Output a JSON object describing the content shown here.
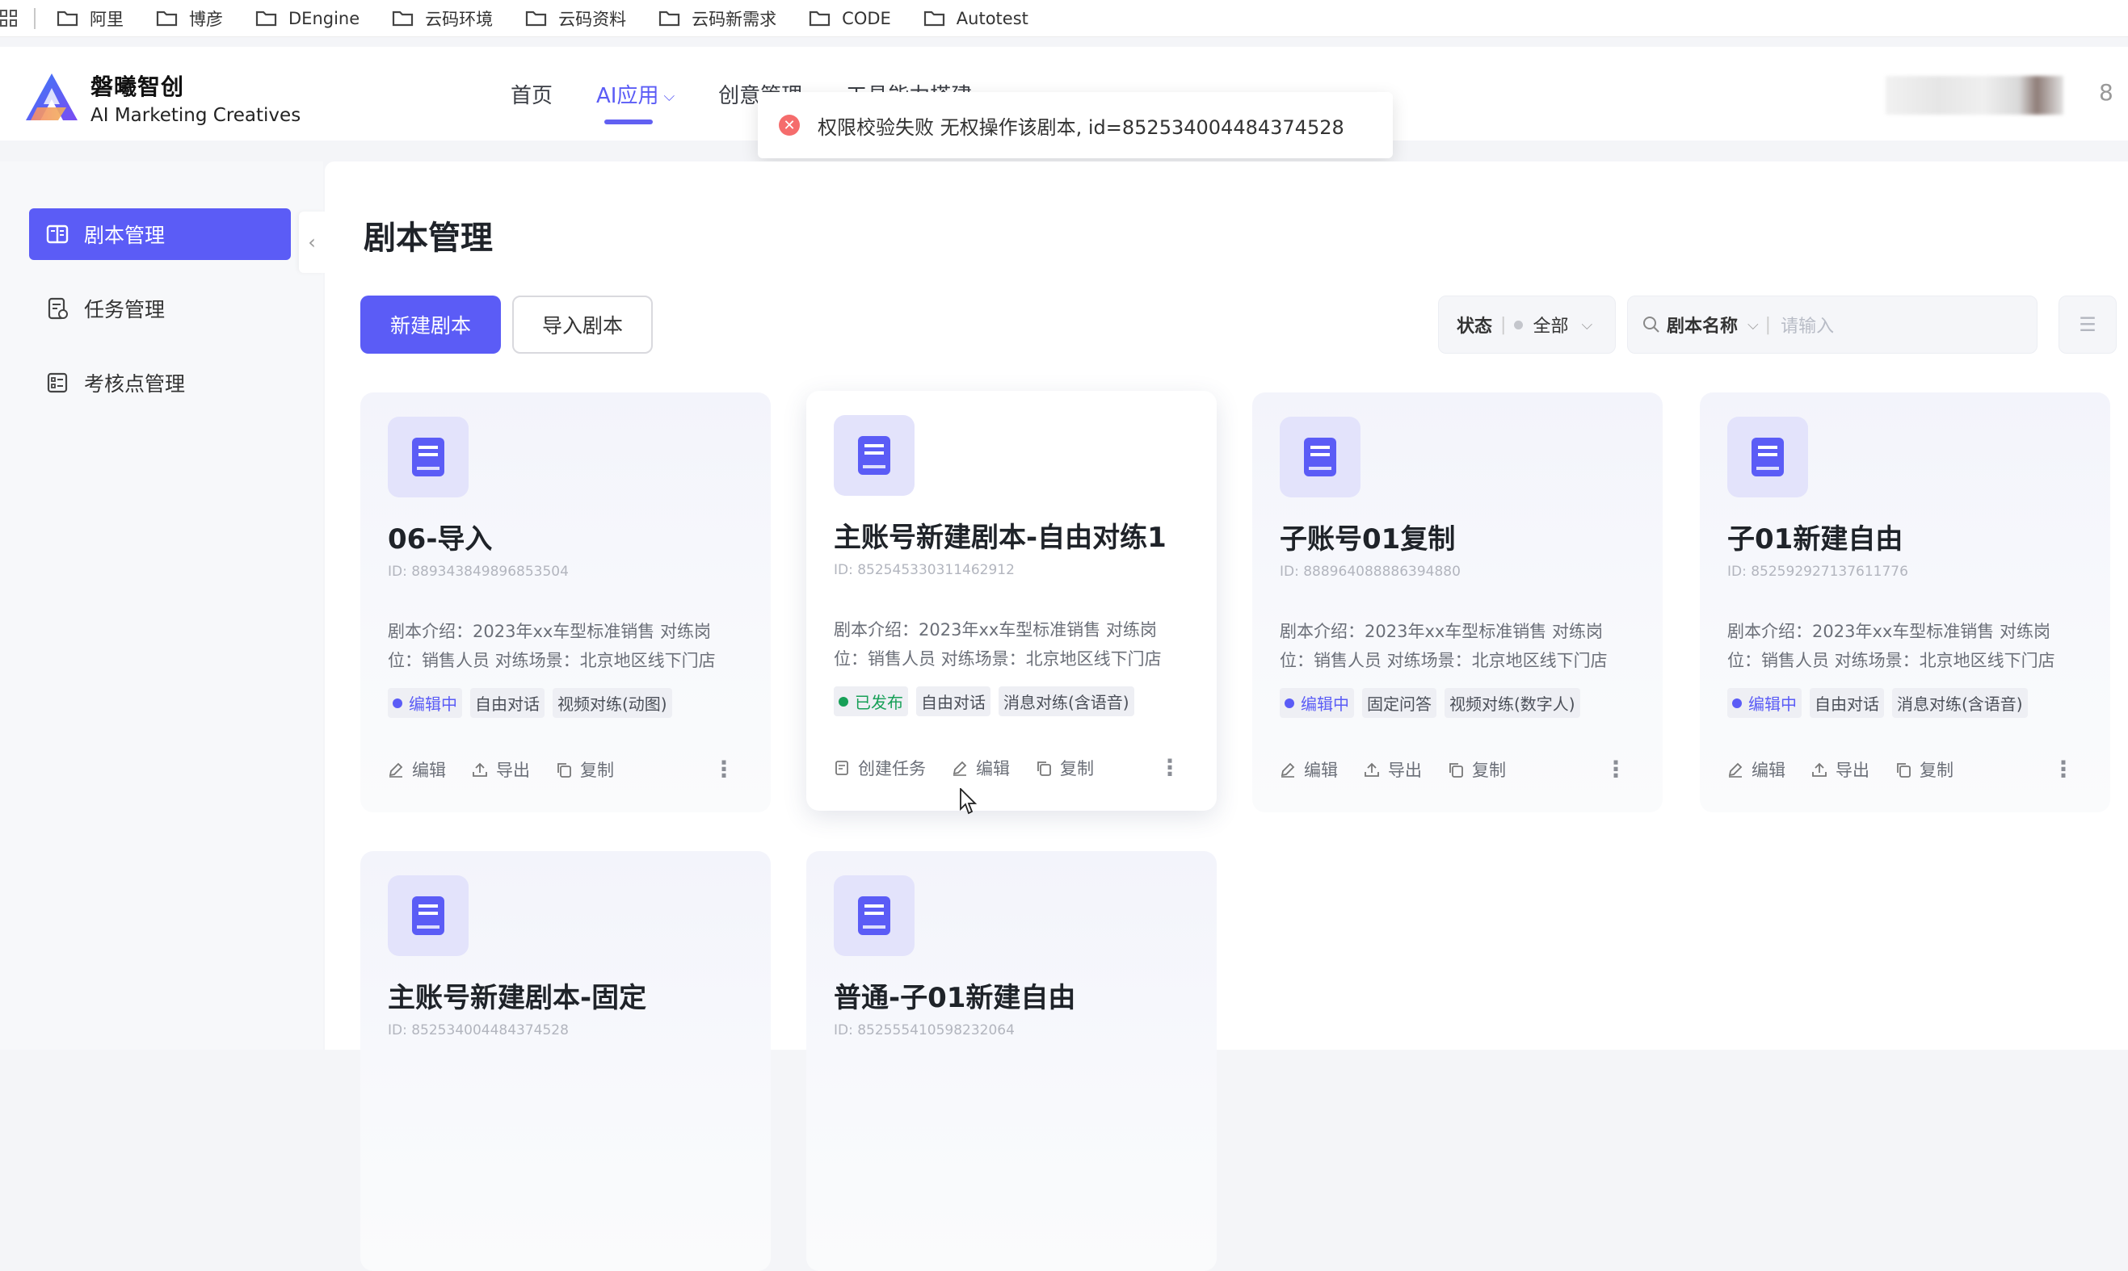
{
  "bookmarks": {
    "items": [
      "阿里",
      "博彦",
      "DEngine",
      "云码环境",
      "云码资料",
      "云码新需求",
      "CODE",
      "Autotest"
    ]
  },
  "header": {
    "logo_cn": "磐曦智创",
    "logo_en": "AI Marketing Creatives",
    "nav": [
      {
        "label": "首页"
      },
      {
        "label": "AI应用",
        "active": true
      },
      {
        "label": "创意管理"
      },
      {
        "label": "工具能力搭建"
      }
    ],
    "nav_rest": "8"
  },
  "toast": {
    "type": "error",
    "icon": "error-circle-icon",
    "message": "权限校验失败 无权操作该剧本, id=852534004484374528"
  },
  "sidebar": {
    "items": [
      {
        "label": "剧本管理",
        "icon": "book-icon",
        "active": true
      },
      {
        "label": "任务管理",
        "icon": "task-icon"
      },
      {
        "label": "考核点管理",
        "icon": "checklist-icon"
      }
    ]
  },
  "main": {
    "title": "剧本管理",
    "new_button": "新建剧本",
    "import_button": "导入剧本",
    "filter_status_label": "状态",
    "filter_status_value": "全部",
    "search_field_label": "剧本名称",
    "search_placeholder": "请输入"
  },
  "actions": {
    "create_task": "创建任务",
    "edit": "编辑",
    "export": "导出",
    "copy": "复制"
  },
  "cards": [
    {
      "title": "06-导入",
      "id": "ID: 889343849896853504",
      "desc": "剧本介绍：2023年xx车型标准销售 对练岗位：销售人员 对练场景：北京地区线下门店",
      "status": "编辑中",
      "status_type": "edit",
      "tags": [
        "自由对话",
        "视频对练(动图)"
      ]
    },
    {
      "title": "主账号新建剧本-自由对练1",
      "id": "ID: 852545330311462912",
      "desc": "剧本介绍：2023年xx车型标准销售 对练岗位：销售人员 对练场景：北京地区线下门店",
      "status": "已发布",
      "status_type": "published",
      "tags": [
        "自由对话",
        "消息对练(含语音)"
      ]
    },
    {
      "title": "子账号01复制",
      "id": "ID: 888964088886394880",
      "desc": "剧本介绍：2023年xx车型标准销售 对练岗位：销售人员 对练场景：北京地区线下门店",
      "status": "编辑中",
      "status_type": "edit",
      "tags": [
        "固定问答",
        "视频对练(数字人)"
      ]
    },
    {
      "title": "子01新建自由",
      "id": "ID: 852592927137611776",
      "desc": "剧本介绍：2023年xx车型标准销售 对练岗位：销售人员 对练场景：北京地区线下门店",
      "status": "编辑中",
      "status_type": "edit",
      "tags": [
        "自由对话",
        "消息对练(含语音)"
      ]
    },
    {
      "title": "主账号新建剧本-固定",
      "id": "ID: 852534004484374528"
    },
    {
      "title": "普通-子01新建自由",
      "id": "ID: 852555410598232064"
    }
  ],
  "colors": {
    "primary": "#5b5cf6",
    "published": "#18a058",
    "error": "#f56c6c"
  }
}
